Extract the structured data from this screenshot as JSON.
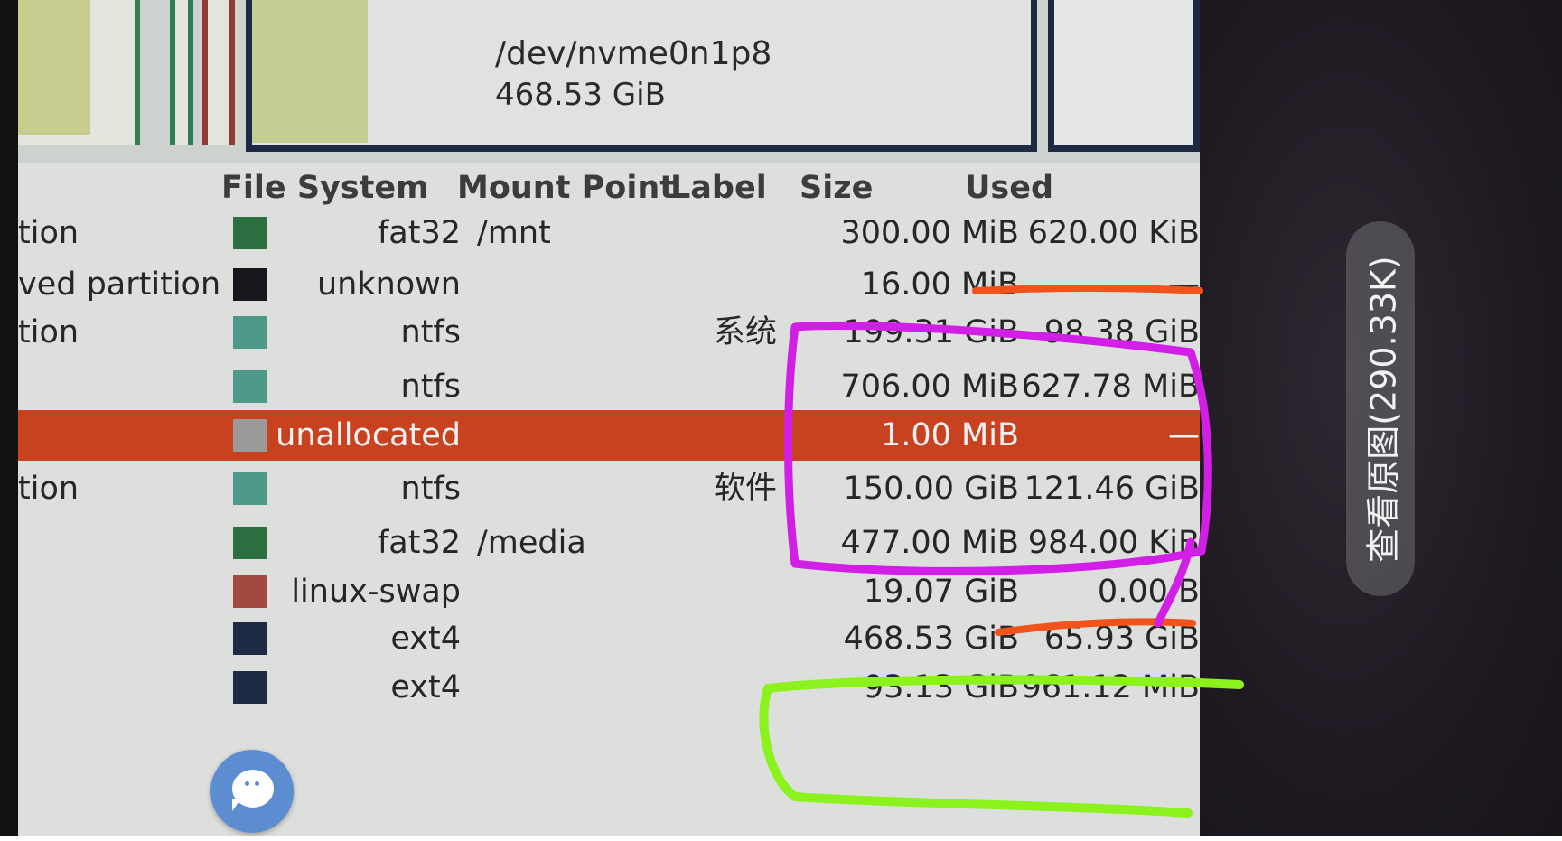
{
  "graph": {
    "selected_partition": "/dev/nvme0n1p8",
    "selected_size": "468.53 GiB"
  },
  "columns": {
    "file_system": "File System",
    "mount_point": "Mount Point",
    "label": "Label",
    "size": "Size",
    "used": "Used"
  },
  "rows": [
    {
      "name": "tion",
      "fs": "fat32",
      "swatch": "#2b6e3f",
      "mount": "/mnt",
      "label": "",
      "size": "300.00 MiB",
      "used": "620.00 KiB"
    },
    {
      "name": "ved partition",
      "fs": "unknown",
      "swatch": "#15171c",
      "mount": "",
      "label": "",
      "size": "16.00 MiB",
      "used": "—"
    },
    {
      "name": "tion",
      "fs": "ntfs",
      "swatch": "#4d9a8b",
      "mount": "",
      "label": "系统",
      "size": "199.31 GiB",
      "used": "98.38 GiB"
    },
    {
      "name": "",
      "fs": "ntfs",
      "swatch": "#4d9a8b",
      "mount": "",
      "label": "",
      "size": "706.00 MiB",
      "used": "627.78 MiB"
    },
    {
      "name": "",
      "fs": "unallocated",
      "swatch": "#9a9a9a",
      "mount": "",
      "label": "",
      "size": "1.00 MiB",
      "used": "—",
      "selected": true
    },
    {
      "name": "tion",
      "fs": "ntfs",
      "swatch": "#4d9a8b",
      "mount": "",
      "label": "软件",
      "size": "150.00 GiB",
      "used": "121.46 GiB"
    },
    {
      "name": "",
      "fs": "fat32",
      "swatch": "#2b6e3f",
      "mount": "/media",
      "label": "",
      "size": "477.00 MiB",
      "used": "984.00 KiB"
    },
    {
      "name": "",
      "fs": "linux-swap",
      "swatch": "#a24a3f",
      "mount": "",
      "label": "",
      "size": "19.07 GiB",
      "used": "0.00 B"
    },
    {
      "name": "",
      "fs": "ext4",
      "swatch": "#1e2a43",
      "mount": "",
      "label": "",
      "size": "468.53 GiB",
      "used": "65.93 GiB"
    },
    {
      "name": "",
      "fs": "ext4",
      "swatch": "#1e2a43",
      "mount": "",
      "label": "",
      "size": "93.13 GiB",
      "used": "961.12 MiB"
    }
  ],
  "overlay": {
    "view_original": "查看原图(290.33K)"
  },
  "colors": {
    "selected_row": "#c8421f",
    "annotation_orange": "#f0541c",
    "annotation_purple": "#d21fe6",
    "annotation_green": "#8cf21e"
  }
}
